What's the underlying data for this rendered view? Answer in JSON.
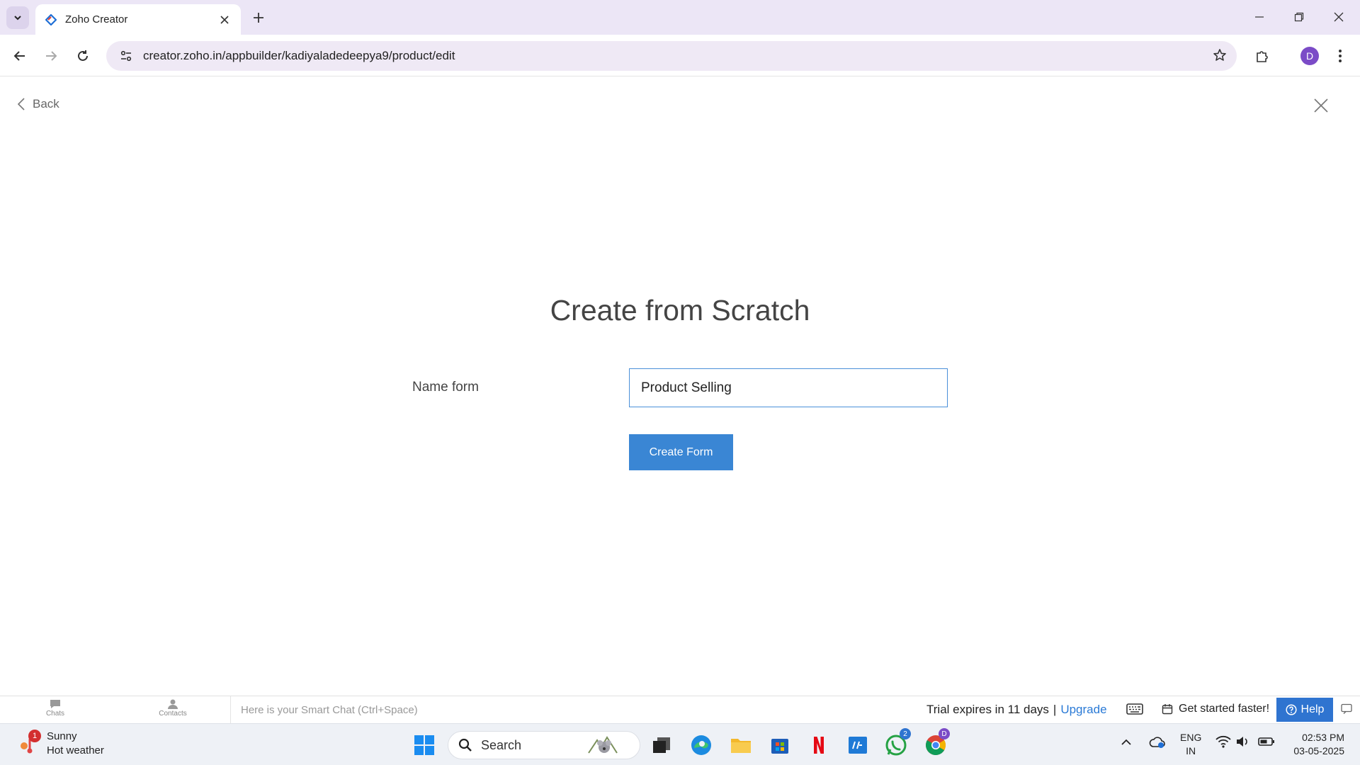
{
  "browser": {
    "tab_title": "Zoho Creator",
    "url": "creator.zoho.in/appbuilder/kadiyaladedeepya9/product/edit",
    "profile_initial": "D"
  },
  "page": {
    "back_label": "Back",
    "heading": "Create from Scratch",
    "name_form_label": "Name form",
    "name_form_value": "Product Selling",
    "create_button_label": "Create Form"
  },
  "zoho_bar": {
    "chats_label": "Chats",
    "contacts_label": "Contacts",
    "smart_chat_placeholder": "Here is your Smart Chat (Ctrl+Space)",
    "trial_text": "Trial expires in 11 days",
    "trial_separator": "|",
    "upgrade_label": "Upgrade",
    "get_started_label": "Get started faster!",
    "help_label": "Help"
  },
  "taskbar": {
    "weather_badge": "1",
    "weather_title": "Sunny",
    "weather_subtitle": "Hot weather",
    "search_label": "Search",
    "whatsapp_badge": "2",
    "chrome_badge": "D",
    "lang_top": "ENG",
    "lang_bottom": "IN",
    "time": "02:53 PM",
    "date": "03-05-2025"
  },
  "colors": {
    "accent": "#3a86d4",
    "tabstrip_bg": "#ece6f6",
    "omnibox_bg": "#efe9f5",
    "help_bg": "#2f74d0"
  }
}
